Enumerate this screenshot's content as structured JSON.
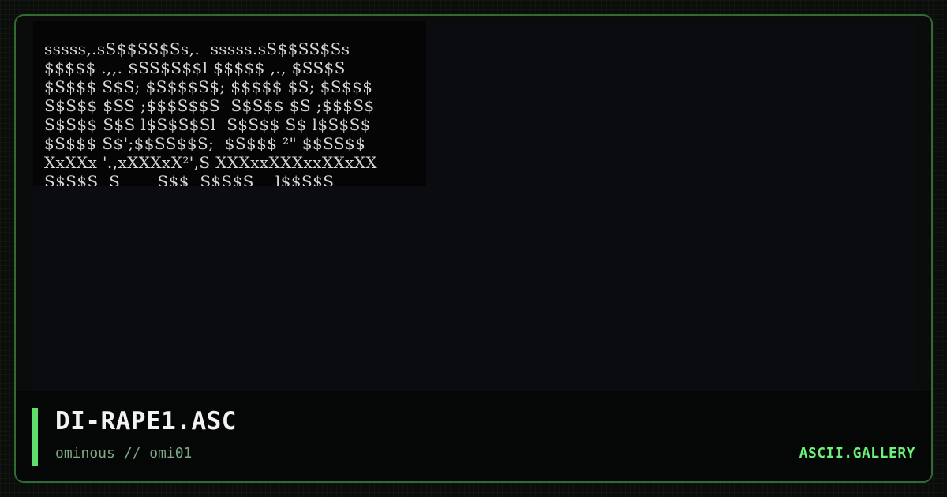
{
  "artwork": {
    "lines": [
      "sssss,.sS$$SS$Ss,.  sssss.sS$$SS$Ss",
      "$$$$$ .,,. $SS$S$$l $$$$$ ,., $SS$S",
      "$S$$$ S$S; $S$$$S$; $$$$$ $S; $S$$$",
      "S$S$$ $SS ;$$$S$$S  S$S$$ $S ;$$$S$",
      "S$S$$ S$S l$S$S$Sl  S$S$$ S$ l$S$S$",
      "$S$$$ S$';$$SS$$S;  $S$$$ ²\" $$SS$$",
      "XxXXx '.,xXXXxX²',S XXXxxXXXxxXXxXX",
      "S$S$S  S       S$$  S$S$S    l$$S$S"
    ]
  },
  "title": "DI-RAPE1.ASC",
  "subtitle": "ominous // omi01",
  "brand": "ASCII.GALLERY",
  "colors": {
    "accent": "#5ee06a",
    "brand": "#6ef07a",
    "border": "#2f6b33",
    "subtitle": "#7fa884"
  }
}
